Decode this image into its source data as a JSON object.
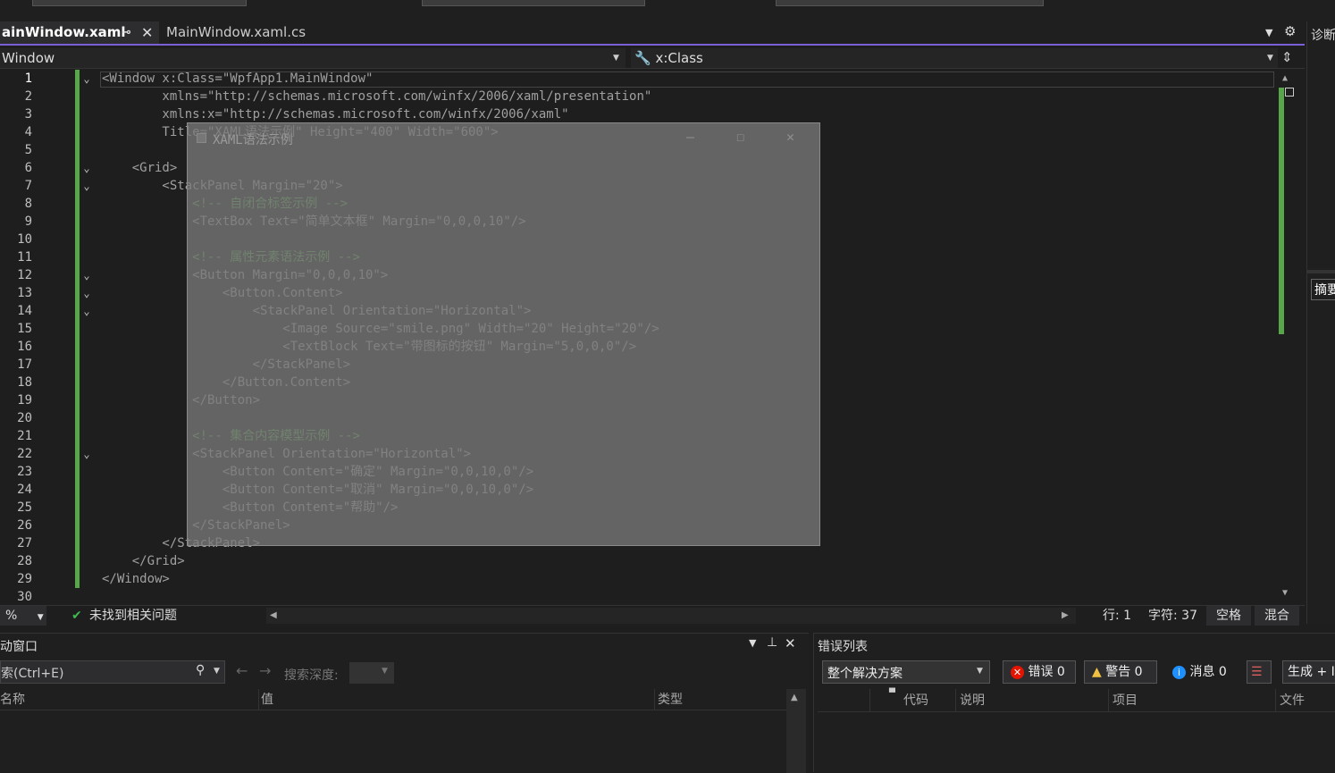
{
  "tabs": [
    {
      "label": "ainWindow.xaml",
      "active": true,
      "pin": "⊸",
      "close": "✕"
    },
    {
      "label": "MainWindow.xaml.cs",
      "active": false
    }
  ],
  "nav": {
    "left": "Window",
    "right": "x:Class"
  },
  "editor": {
    "line_numbers": [
      "1",
      "2",
      "3",
      "4",
      "5",
      "6",
      "7",
      "8",
      "9",
      "10",
      "11",
      "12",
      "13",
      "14",
      "15",
      "16",
      "17",
      "18",
      "19",
      "20",
      "21",
      "22",
      "23",
      "24",
      "25",
      "26",
      "27",
      "28",
      "29",
      "30"
    ],
    "lines": [
      "<Window x:Class=\"WpfApp1.MainWindow\"",
      "        xmlns=\"http://schemas.microsoft.com/winfx/2006/xaml/presentation\"",
      "        xmlns:x=\"http://schemas.microsoft.com/winfx/2006/xaml\"",
      "        Title=\"XAML语法示例\" Height=\"400\" Width=\"600\">",
      "",
      "    <Grid>",
      "        <StackPanel Margin=\"20\">",
      "            <!-- 自闭合标签示例 -->",
      "            <TextBox Text=\"简单文本框\" Margin=\"0,0,0,10\"/>",
      "",
      "            <!-- 属性元素语法示例 -->",
      "            <Button Margin=\"0,0,0,10\">",
      "                <Button.Content>",
      "                    <StackPanel Orientation=\"Horizontal\">",
      "                        <Image Source=\"smile.png\" Width=\"20\" Height=\"20\"/>",
      "                        <TextBlock Text=\"带图标的按钮\" Margin=\"5,0,0,0\"/>",
      "                    </StackPanel>",
      "                </Button.Content>",
      "            </Button>",
      "",
      "            <!-- 集合内容模型示例 -->",
      "            <StackPanel Orientation=\"Horizontal\">",
      "                <Button Content=\"确定\" Margin=\"0,0,10,0\"/>",
      "                <Button Content=\"取消\" Margin=\"0,0,10,0\"/>",
      "                <Button Content=\"帮助\"/>",
      "            </StackPanel>",
      "        </StackPanel>",
      "    </Grid>",
      "</Window>",
      ""
    ]
  },
  "overlay": {
    "title": "XAML语法示例",
    "minimize": "—",
    "maximize": "☐",
    "close": "✕"
  },
  "status": {
    "zoom": "%",
    "issues": "未找到相关问题",
    "row": "行: 1",
    "col": "字符: 37",
    "spaces": "空格",
    "eol": "混合"
  },
  "right_panel": {
    "diag": "诊断",
    "summary": "摘要"
  },
  "autos": {
    "title": "动窗口",
    "search_placeholder": "索(Ctrl+E)",
    "depth_label": "搜索深度:",
    "columns": [
      "名称",
      "值",
      "类型"
    ]
  },
  "errors": {
    "title": "错误列表",
    "scope": "整个解决方案",
    "errors": "错误 0",
    "warnings": "警告 0",
    "messages": "消息 0",
    "build": "生成 + I",
    "columns": [
      "代码",
      "说明",
      "项目",
      "文件"
    ]
  },
  "colors": {
    "accent": "#7a5fd6",
    "green": "#57a64a",
    "comment": "#57a64a"
  }
}
